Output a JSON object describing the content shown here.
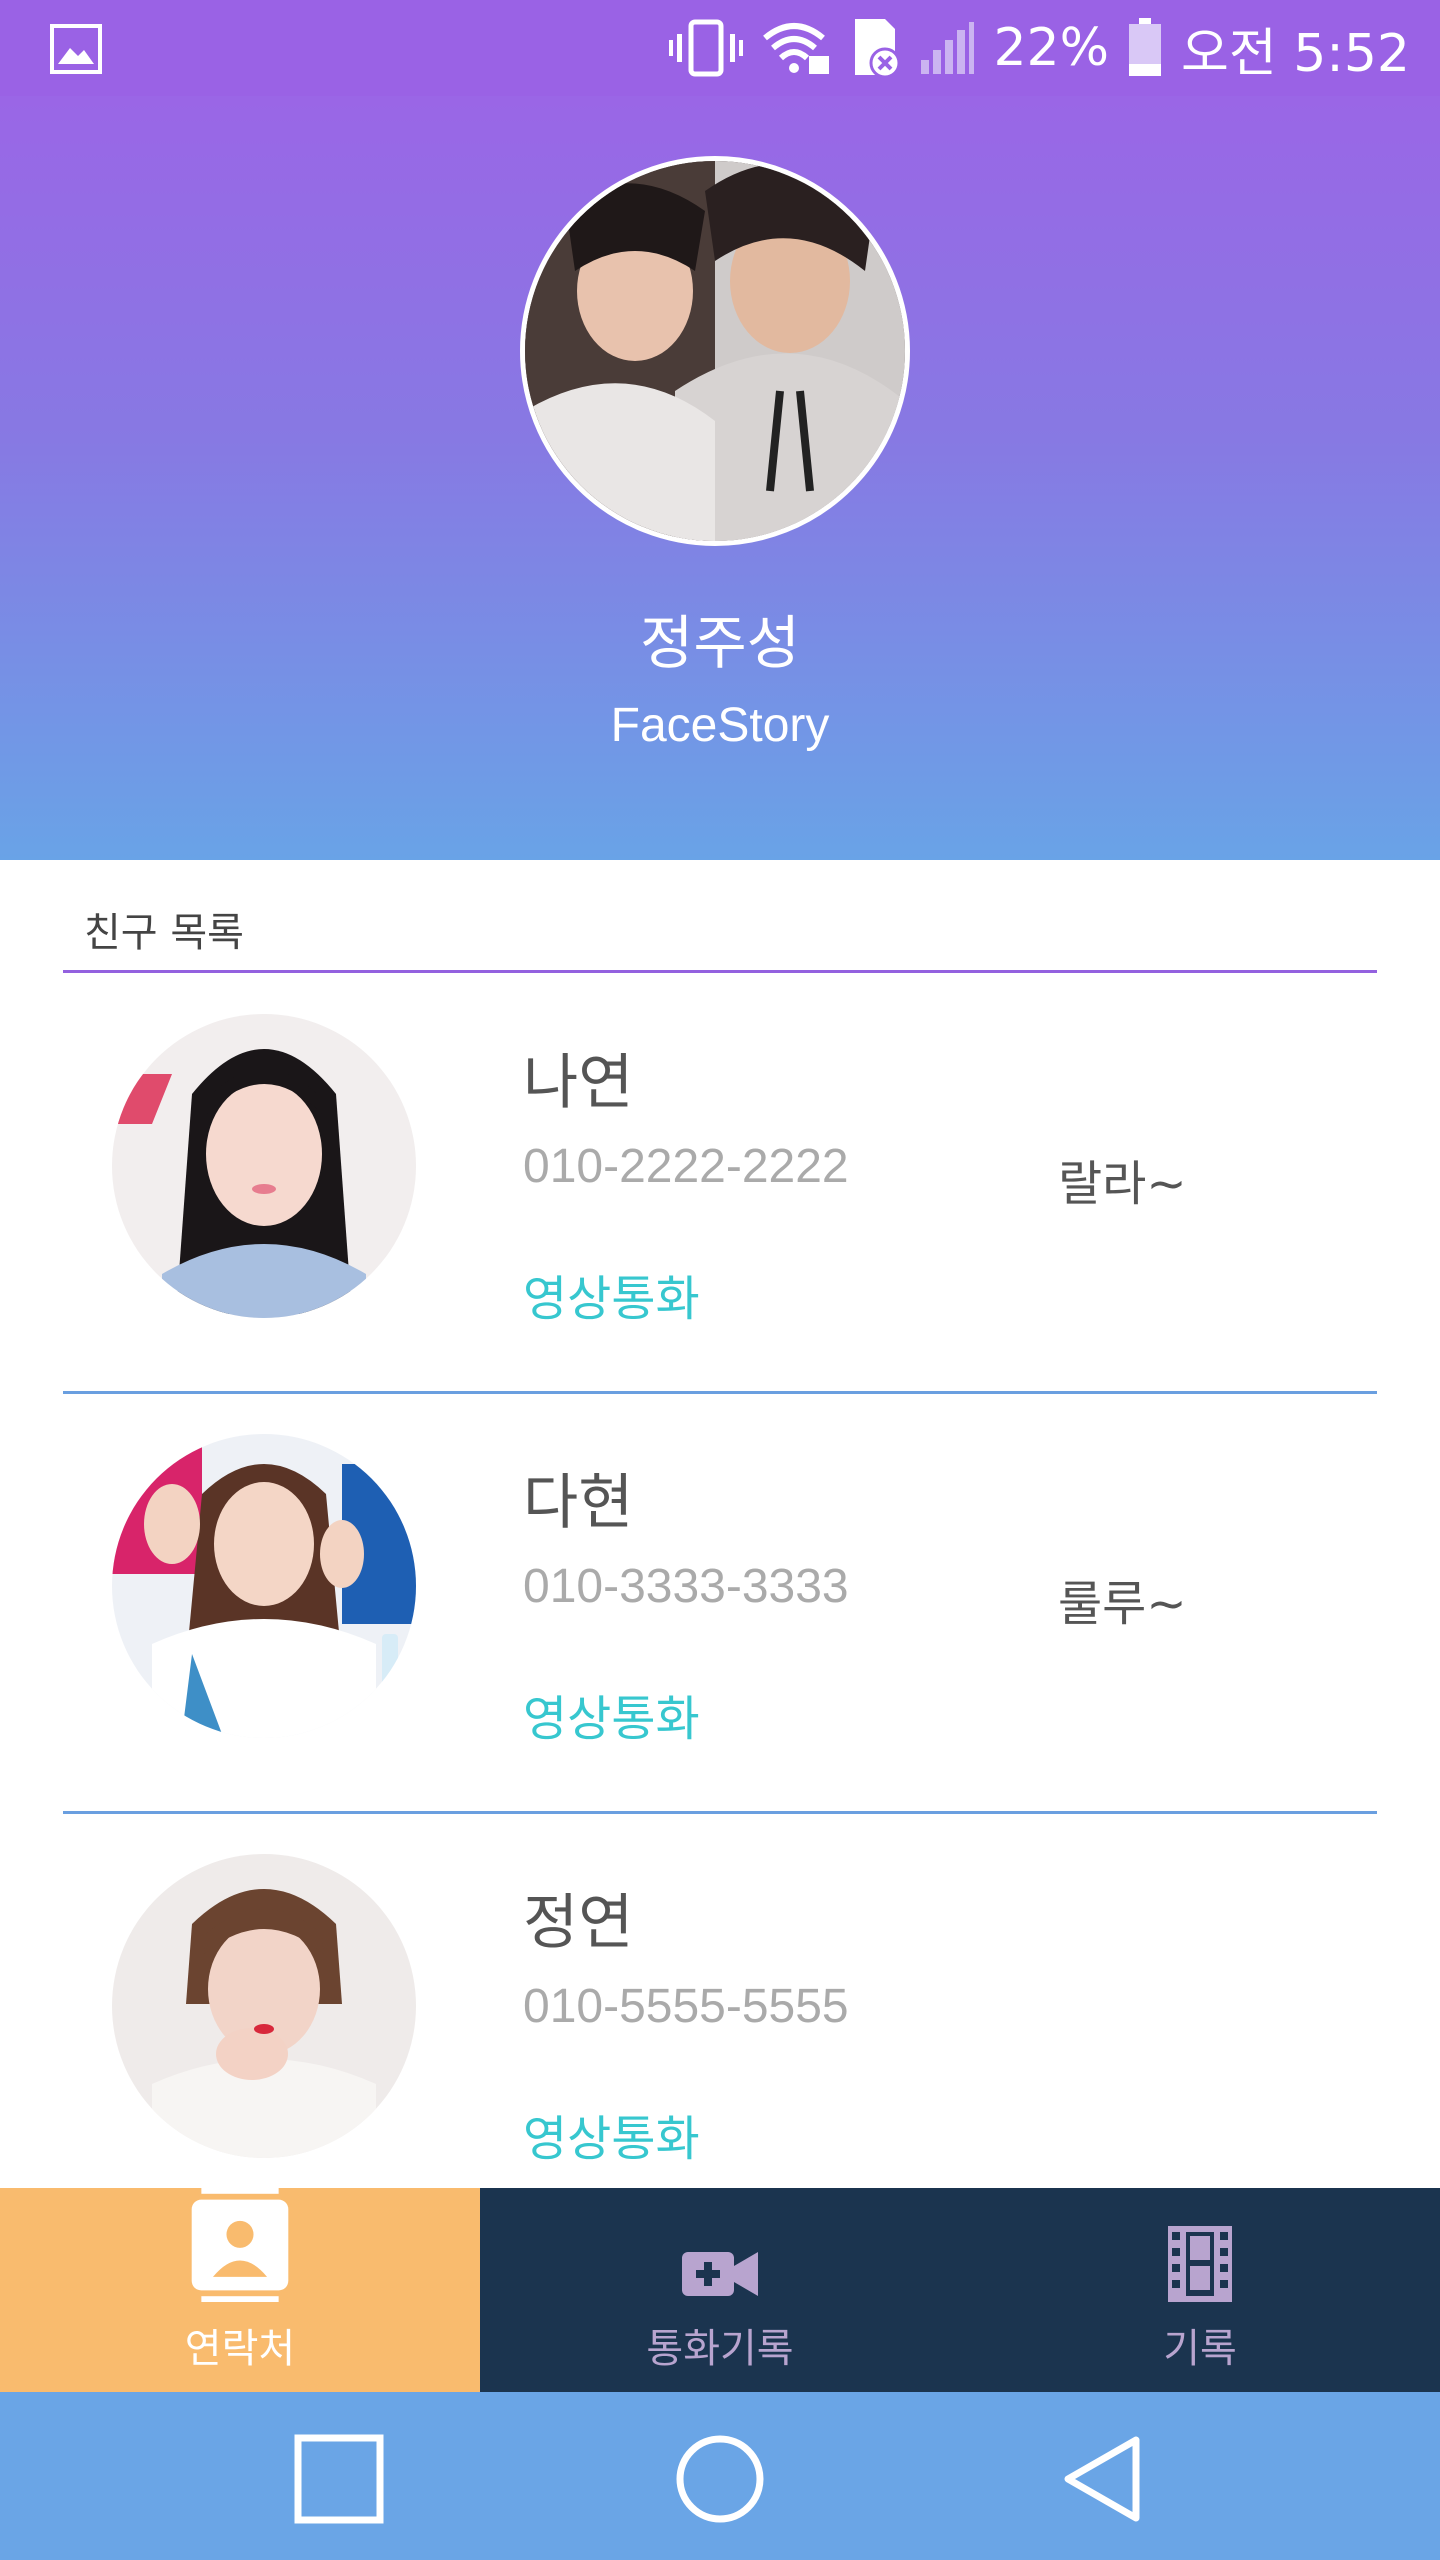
{
  "status_bar": {
    "battery_percent": "22%",
    "time": "오전 5:52",
    "icons": [
      "gallery-icon",
      "vibrate-icon",
      "wifi-lock-icon",
      "sd-card-icon",
      "signal-icon",
      "battery-icon"
    ]
  },
  "profile": {
    "name": "정주성",
    "subtitle": "FaceStory"
  },
  "section": {
    "title": "친구 목록"
  },
  "friends": [
    {
      "name": "나연",
      "phone": "010-2222-2222",
      "status": "랄라~",
      "video_call": "영상통화"
    },
    {
      "name": "다현",
      "phone": "010-3333-3333",
      "status": "룰루~",
      "video_call": "영상통화"
    },
    {
      "name": "정연",
      "phone": "010-5555-5555",
      "status": "",
      "video_call": "영상통화"
    }
  ],
  "tabs": [
    {
      "label": "연락처",
      "icon": "contacts-icon",
      "active": true
    },
    {
      "label": "통화기록",
      "icon": "video-add-icon",
      "active": false
    },
    {
      "label": "기록",
      "icon": "film-icon",
      "active": false
    }
  ],
  "nav": {
    "buttons": [
      "recent-apps-icon",
      "home-icon",
      "back-icon"
    ]
  },
  "colors": {
    "status_bar": "#9a62e5",
    "header_top": "#9a66e6",
    "header_bottom": "#69a3e7",
    "accent_video": "#37c7cf",
    "tab_active": "#f9bb6e",
    "tab_bar": "#1b344f",
    "nav_bar": "#6aa5e6"
  }
}
